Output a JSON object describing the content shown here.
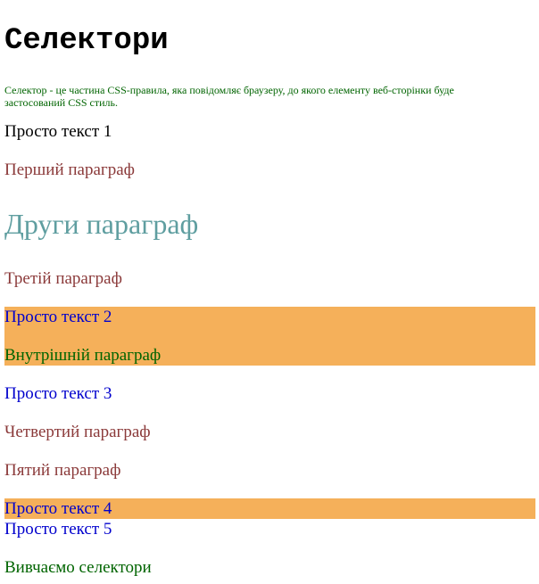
{
  "heading": "Селектори",
  "intro": "Селектор - це частина CSS-правила, яка повідомляє браузеру, до якого елементу веб-сторінки буде застосований CSS стиль.",
  "items": [
    "Просто текст 1",
    "Перший параграф",
    "Други параграф",
    "Третій параграф",
    "Просто текст 2",
    "Внутрішній параграф",
    "Просто текст 3",
    "Четвертий параграф",
    "Пятий параграф",
    "Просто текст 4",
    "Просто текст 5",
    "Вивчаємо селектори"
  ],
  "colors": {
    "highlight": "#f5b05a",
    "paragraph": "#8b3a3a",
    "plain_blue": "#0000cd",
    "green": "#006400",
    "big_paragraph": "#5f9ea0"
  }
}
